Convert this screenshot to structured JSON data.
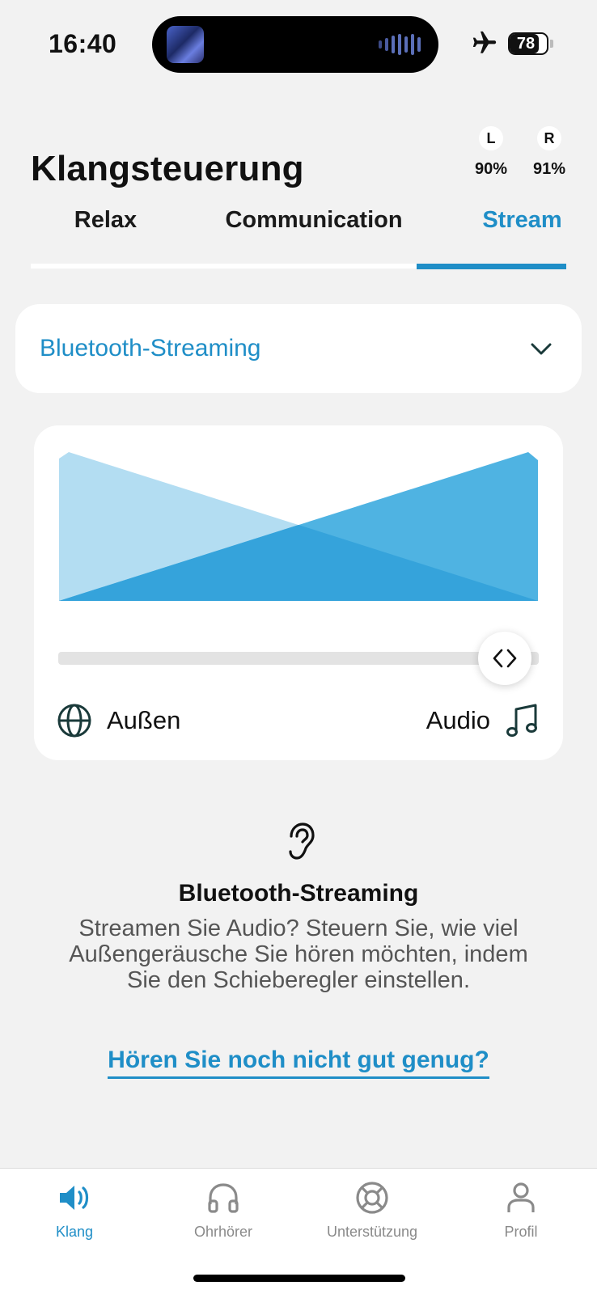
{
  "status_bar": {
    "time": "16:40",
    "battery": "78",
    "battery_fraction": 0.78
  },
  "header": {
    "title": "Klangsteuerung",
    "earbuds": [
      {
        "side": "L",
        "level": "90%"
      },
      {
        "side": "R",
        "level": "91%"
      }
    ]
  },
  "tabs": [
    {
      "label": "Relax",
      "active": false
    },
    {
      "label": "Communication",
      "active": false
    },
    {
      "label": "Stream",
      "active": true
    }
  ],
  "mode_select": {
    "value": "Bluetooth-Streaming"
  },
  "mixer": {
    "left_label": "Außen",
    "right_label": "Audio",
    "slider_value_fraction": 0.93,
    "colors": {
      "ambient": "#b3ddf2",
      "audio": "#4fb3e2",
      "overlap": "#35a3db"
    }
  },
  "info": {
    "icon": "ear-icon",
    "title": "Bluetooth-Streaming",
    "body": "Streamen Sie Audio? Steuern Sie, wie viel Außengeräusche Sie hören möchten, indem Sie den Schieberegler einstellen.",
    "link": "Hören Sie noch nicht gut genug?"
  },
  "bottom_nav": [
    {
      "label": "Klang",
      "icon": "speaker-icon",
      "active": true
    },
    {
      "label": "Ohrhörer",
      "icon": "headphones-icon",
      "active": false
    },
    {
      "label": "Unterstützung",
      "icon": "lifebuoy-icon",
      "active": false
    },
    {
      "label": "Profil",
      "icon": "person-icon",
      "active": false
    }
  ],
  "accent_color": "#1f8ec7"
}
